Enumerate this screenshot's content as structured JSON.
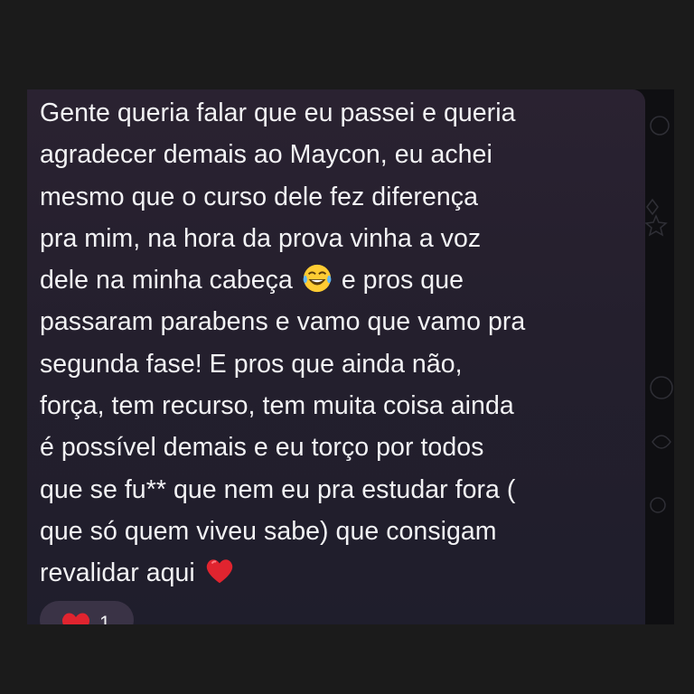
{
  "message": {
    "lines": [
      "Gente queria falar que eu passei e queria",
      "agradecer demais ao Maycon, eu achei",
      "mesmo que o curso dele fez diferença",
      "pra mim, na hora da prova vinha a voz",
      "dele na minha cabeça",
      "e pros que",
      "passaram parabens e vamo que vamo pra",
      "segunda fase! E pros que ainda não,",
      "força, tem recurso, tem muita coisa ainda",
      "é possível demais e eu torço por todos",
      "que se fu** que nem eu pra estudar fora (",
      "que só quem viveu sabe) que consigam",
      "revalidar aqui"
    ],
    "emojis": {
      "laughing": "laughing-with-tears-emoji",
      "heart": "red-heart-emoji"
    }
  },
  "reaction": {
    "emoji": "red-heart",
    "count": "1"
  },
  "colors": {
    "page_background": "#1b1b1b",
    "bubble_top": "#2a2231",
    "bubble_bottom": "#1f1e2c",
    "text": "#f2f2f4",
    "heart": "#e0242f"
  }
}
